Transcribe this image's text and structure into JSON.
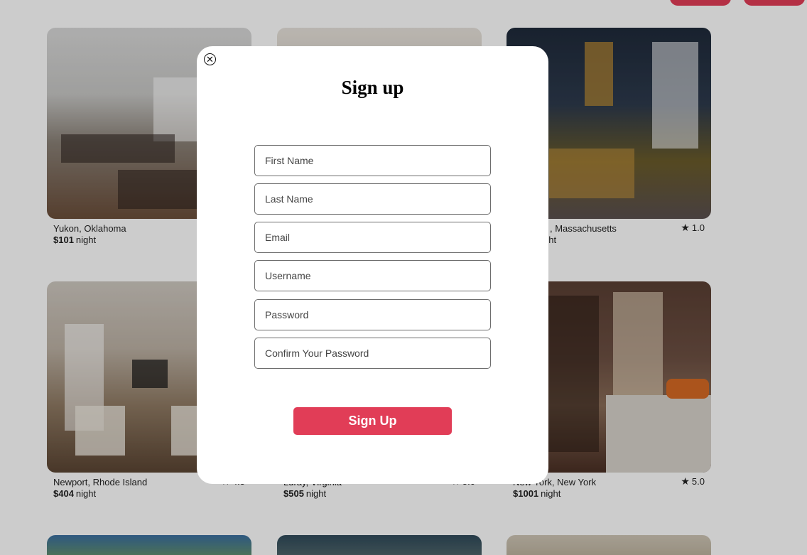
{
  "modal": {
    "title": "Sign up",
    "close_symbol": "✕",
    "fields": {
      "first_name_placeholder": "First Name",
      "last_name_placeholder": "Last Name",
      "email_placeholder": "Email",
      "username_placeholder": "Username",
      "password_placeholder": "Password",
      "confirm_password_placeholder": "Confirm Your Password"
    },
    "submit_label": "Sign Up"
  },
  "listings": [
    {
      "location": "Yukon, Oklahoma",
      "price": "$101",
      "unit": "night",
      "rating": ""
    },
    {
      "location": "",
      "price": "",
      "unit": "",
      "rating": ""
    },
    {
      "location": ", Massachusetts",
      "price": "",
      "unit": "ght",
      "rating": "1.0"
    },
    {
      "location": "Newport, Rhode Island",
      "price": "$404",
      "unit": "night",
      "rating": "4.5"
    },
    {
      "location": "Luray, Virginia",
      "price": "$505",
      "unit": "night",
      "rating": "5.0"
    },
    {
      "location": "New York, New York",
      "price": "$1001",
      "unit": "night",
      "rating": "5.0"
    }
  ],
  "icons": {
    "star": "★"
  },
  "colors": {
    "brand": "#e13d57",
    "overlay": "rgba(0,0,0,0.20)"
  }
}
